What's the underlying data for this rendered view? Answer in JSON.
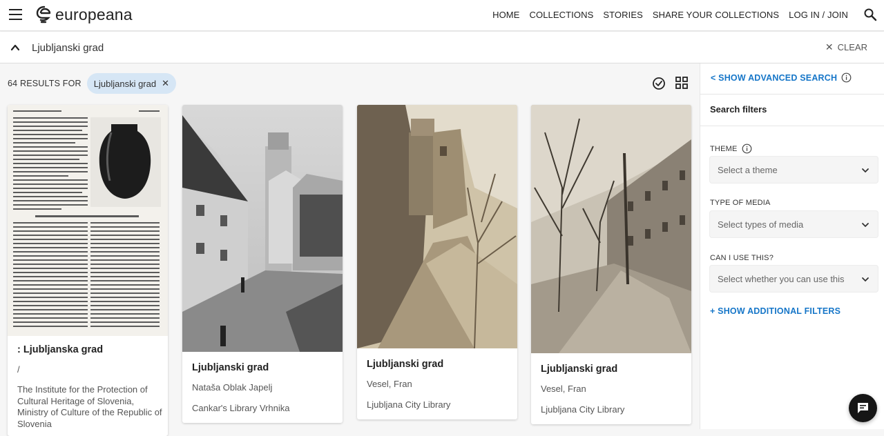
{
  "header": {
    "logo_text": "europeana",
    "nav": [
      "HOME",
      "COLLECTIONS",
      "STORIES",
      "SHARE YOUR COLLECTIONS",
      "LOG IN / JOIN"
    ]
  },
  "search": {
    "query": "Ljubljanski grad",
    "clear_label": "CLEAR"
  },
  "results": {
    "count_label": "64 RESULTS FOR",
    "chip_label": "Ljubljanski grad"
  },
  "cards": [
    {
      "title": ": Ljubljanska grad",
      "line1": "/",
      "line2": "The Institute for the Protection of Cultural Heritage of Slovenia, Ministry of Culture of the Republic of Slovenia"
    },
    {
      "title": "Ljubljanski grad",
      "line1": "Nataša Oblak Japelj",
      "line2": "Cankar's Library Vrhnika"
    },
    {
      "title": "Ljubljanski grad",
      "line1": "Vesel, Fran",
      "line2": "Ljubljana City Library"
    },
    {
      "title": "Ljubljanski grad",
      "line1": "Vesel, Fran",
      "line2": "Ljubljana City Library"
    }
  ],
  "sidebar": {
    "advanced_label": "< SHOW ADVANCED SEARCH",
    "filters_title": "Search filters",
    "theme_label": "THEME",
    "theme_placeholder": "Select a theme",
    "media_label": "TYPE OF MEDIA",
    "media_placeholder": "Select types of media",
    "rights_label": "CAN I USE THIS?",
    "rights_placeholder": "Select whether you can use this",
    "more_label": "+ SHOW ADDITIONAL FILTERS"
  },
  "colors": {
    "accent": "#1676c8",
    "chip": "#d6e6f5"
  }
}
